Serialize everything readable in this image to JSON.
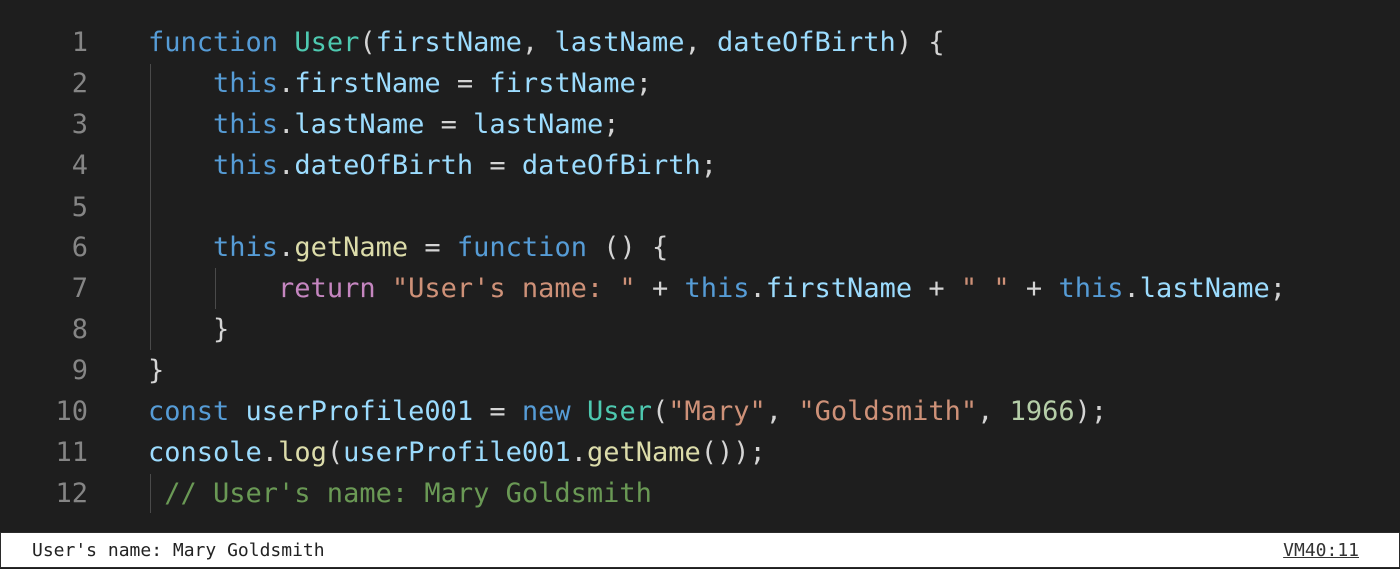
{
  "editor": {
    "line_numbers": [
      "1",
      "2",
      "3",
      "4",
      "5",
      "6",
      "7",
      "8",
      "9",
      "10",
      "11",
      "12"
    ],
    "colors": {
      "background": "#1e1e1e",
      "keyword": "#569cd6",
      "control_keyword": "#c586c0",
      "function": "#dcdcaa",
      "class": "#4ec9b0",
      "variable": "#9cdcfe",
      "string": "#ce9178",
      "number": "#b5cea8",
      "comment": "#6a9955",
      "punctuation": "#d4d4d4"
    },
    "lines": [
      [
        {
          "t": "function",
          "c": "k"
        },
        {
          "t": " ",
          "c": "p"
        },
        {
          "t": "User",
          "c": "cls"
        },
        {
          "t": "(",
          "c": "p"
        },
        {
          "t": "firstName",
          "c": "v"
        },
        {
          "t": ", ",
          "c": "p"
        },
        {
          "t": "lastName",
          "c": "v"
        },
        {
          "t": ", ",
          "c": "p"
        },
        {
          "t": "dateOfBirth",
          "c": "v"
        },
        {
          "t": ") {",
          "c": "p"
        }
      ],
      [
        {
          "t": "    ",
          "c": "p"
        },
        {
          "t": "this",
          "c": "k"
        },
        {
          "t": ".",
          "c": "p"
        },
        {
          "t": "firstName",
          "c": "v"
        },
        {
          "t": " = ",
          "c": "p"
        },
        {
          "t": "firstName",
          "c": "v"
        },
        {
          "t": ";",
          "c": "p"
        }
      ],
      [
        {
          "t": "    ",
          "c": "p"
        },
        {
          "t": "this",
          "c": "k"
        },
        {
          "t": ".",
          "c": "p"
        },
        {
          "t": "lastName",
          "c": "v"
        },
        {
          "t": " = ",
          "c": "p"
        },
        {
          "t": "lastName",
          "c": "v"
        },
        {
          "t": ";",
          "c": "p"
        }
      ],
      [
        {
          "t": "    ",
          "c": "p"
        },
        {
          "t": "this",
          "c": "k"
        },
        {
          "t": ".",
          "c": "p"
        },
        {
          "t": "dateOfBirth",
          "c": "v"
        },
        {
          "t": " = ",
          "c": "p"
        },
        {
          "t": "dateOfBirth",
          "c": "v"
        },
        {
          "t": ";",
          "c": "p"
        }
      ],
      [],
      [
        {
          "t": "    ",
          "c": "p"
        },
        {
          "t": "this",
          "c": "k"
        },
        {
          "t": ".",
          "c": "p"
        },
        {
          "t": "getName",
          "c": "fn"
        },
        {
          "t": " = ",
          "c": "p"
        },
        {
          "t": "function",
          "c": "k"
        },
        {
          "t": " () {",
          "c": "p"
        }
      ],
      [
        {
          "t": "        ",
          "c": "p"
        },
        {
          "t": "return",
          "c": "ret"
        },
        {
          "t": " ",
          "c": "p"
        },
        {
          "t": "\"User's name: \"",
          "c": "s"
        },
        {
          "t": " + ",
          "c": "p"
        },
        {
          "t": "this",
          "c": "k"
        },
        {
          "t": ".",
          "c": "p"
        },
        {
          "t": "firstName",
          "c": "v"
        },
        {
          "t": " + ",
          "c": "p"
        },
        {
          "t": "\" \"",
          "c": "s"
        },
        {
          "t": " + ",
          "c": "p"
        },
        {
          "t": "this",
          "c": "k"
        },
        {
          "t": ".",
          "c": "p"
        },
        {
          "t": "lastName",
          "c": "v"
        },
        {
          "t": ";",
          "c": "p"
        }
      ],
      [
        {
          "t": "    }",
          "c": "p"
        }
      ],
      [
        {
          "t": "}",
          "c": "p"
        }
      ],
      [
        {
          "t": "const",
          "c": "k"
        },
        {
          "t": " ",
          "c": "p"
        },
        {
          "t": "userProfile001",
          "c": "v"
        },
        {
          "t": " = ",
          "c": "p"
        },
        {
          "t": "new",
          "c": "k"
        },
        {
          "t": " ",
          "c": "p"
        },
        {
          "t": "User",
          "c": "cls"
        },
        {
          "t": "(",
          "c": "p"
        },
        {
          "t": "\"Mary\"",
          "c": "s"
        },
        {
          "t": ", ",
          "c": "p"
        },
        {
          "t": "\"Goldsmith\"",
          "c": "s"
        },
        {
          "t": ", ",
          "c": "p"
        },
        {
          "t": "1966",
          "c": "n"
        },
        {
          "t": ");",
          "c": "p"
        }
      ],
      [
        {
          "t": "console",
          "c": "v"
        },
        {
          "t": ".",
          "c": "p"
        },
        {
          "t": "log",
          "c": "fn"
        },
        {
          "t": "(",
          "c": "p"
        },
        {
          "t": "userProfile001",
          "c": "v"
        },
        {
          "t": ".",
          "c": "p"
        },
        {
          "t": "getName",
          "c": "fn"
        },
        {
          "t": "());",
          "c": "p"
        }
      ],
      [
        {
          "t": " // User's name: Mary Goldsmith",
          "c": "c"
        }
      ]
    ]
  },
  "console": {
    "message": "User's name: Mary Goldsmith",
    "source_link": "VM40:11"
  }
}
